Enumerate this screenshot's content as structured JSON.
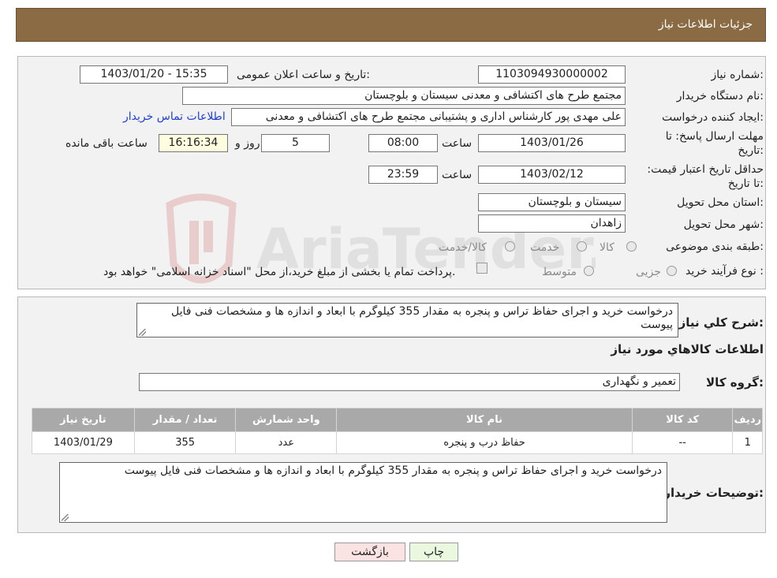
{
  "header": {
    "title": "جزئیات اطلاعات نیاز"
  },
  "fields": {
    "need_number_label": "شماره نیاز:",
    "need_number": "1103094930000002",
    "announce_label": "تاریخ و ساعت اعلان عمومی:",
    "announce_value": "1403/01/20 - 15:35",
    "buyer_org_label": "نام دستگاه خریدار:",
    "buyer_org": "مجتمع طرح های اکتشافی و معدنی سیستان و بلوچستان",
    "creator_label": "ایجاد کننده درخواست:",
    "creator": "علی مهدی پور کارشناس اداری و پشتیبانی مجتمع طرح های اکتشافی و معدنی",
    "contact_link": "اطلاعات تماس خریدار",
    "deadline_label": "مهلت ارسال پاسخ: تا تاریخ:",
    "deadline_date": "1403/01/26",
    "time_label": "ساعت",
    "deadline_time": "08:00",
    "days_value": "5",
    "days_label": "روز و",
    "remaining_time": "16:16:34",
    "remaining_label": "ساعت باقی مانده",
    "validity_label": "حداقل تاریخ اعتبار قیمت: تا تاریخ:",
    "validity_date": "1403/02/12",
    "validity_time": "23:59",
    "province_label": "استان محل تحویل:",
    "province": "سیستان و بلوچستان",
    "city_label": "شهر محل تحویل:",
    "city": "زاهدان",
    "category_label": "طبقه بندی موضوعی:",
    "category_options": [
      "کالا",
      "خدمت",
      "کالا/خدمت"
    ],
    "process_label": "نوع فرآیند خرید :",
    "process_options": [
      "جزیی",
      "متوسط"
    ],
    "process_note": "پرداخت تمام یا بخشی از مبلغ خرید،از محل \"اسناد خزانه اسلامی\" خواهد بود."
  },
  "details": {
    "summary_label": "شرح کلي نياز:",
    "summary_text": "درخواست خرید و اجرای حفاظ تراس و پنجره به مقدار 355 کیلوگرم با ابعاد و اندازه ها و مشخصات فنی فایل پیوست",
    "goods_info_title": "اطلاعات کالاهاي مورد نياز",
    "goods_group_label": "گروه کالا:",
    "goods_group": "تعمیر و نگهداری",
    "table": {
      "headers": [
        "رديف",
        "کد کالا",
        "نام کالا",
        "واحد شمارش",
        "تعداد / مقدار",
        "تاريخ نياز"
      ],
      "rows": [
        [
          "1",
          "--",
          "حفاظ درب و پنجره",
          "عدد",
          "355",
          "1403/01/29"
        ]
      ]
    },
    "buyer_notes_label": "توضيحات خريدار:",
    "buyer_notes": "درخواست خرید و اجرای حفاظ تراس و پنجره به مقدار 355 کیلوگرم با ابعاد و اندازه ها و مشخصات فنی فایل پیوست"
  },
  "buttons": {
    "print": "چاپ",
    "back": "بازگشت"
  },
  "watermark": {
    "text": "AriaTender.neT"
  },
  "colors": {
    "header_bg": "#8b6b43",
    "link": "#1f3fd6",
    "back_btn": "#fbe3e3",
    "print_btn": "#e9f8df"
  }
}
